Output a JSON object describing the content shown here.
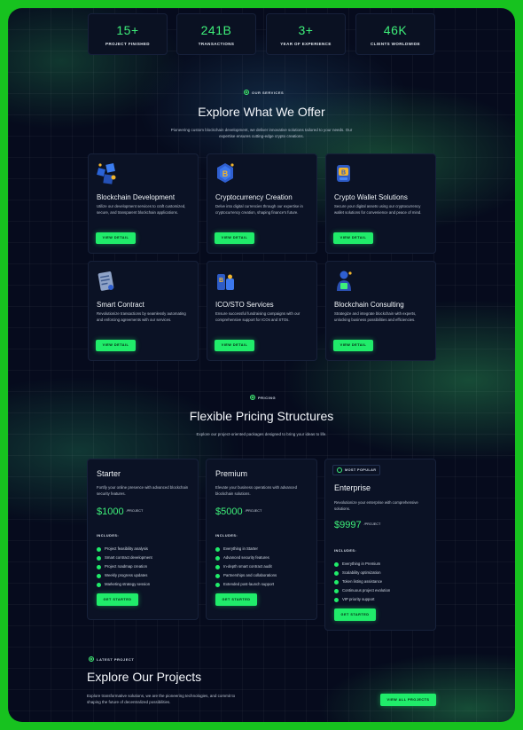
{
  "stats": [
    {
      "value": "15+",
      "label": "PROJECT FINISHED"
    },
    {
      "value": "241B",
      "label": "TRANSACTIONS"
    },
    {
      "value": "3+",
      "label": "YEAR OF EXPERIENCE"
    },
    {
      "value": "46K",
      "label": "CLIENTS WORLDWIDE"
    }
  ],
  "services": {
    "tag": "OUR SERVICES",
    "title": "Explore What We Offer",
    "subtitle": "Pioneering custom blockchain development, we deliver innovative solutions tailored to your needs. Our expertise ensures cutting-edge crypto creations.",
    "button_label": "VIEW DETAIL",
    "cards": [
      {
        "title": "Blockchain Development",
        "desc": "Utilize our development services to craft customized, secure, and transparent blockchain applications.",
        "icon": "blockchain-icon"
      },
      {
        "title": "Cryptocurrency Creation",
        "desc": "Delve into digital currencies through our expertise in cryptocurrency creation, shaping finance's future.",
        "icon": "bitcoin-coin-icon"
      },
      {
        "title": "Crypto Wallet Solutions",
        "desc": "Secure your digital assets using our cryptocurrency wallet solutions for convenience and peace of mind.",
        "icon": "crypto-wallet-icon"
      },
      {
        "title": "Smart Contract",
        "desc": "Revolutionize transactions by seamlessly automating and enforcing agreements with our services.",
        "icon": "contract-scroll-icon"
      },
      {
        "title": "ICO/STO Services",
        "desc": "Ensure successful fundraising campaigns with our comprehensive support for ICOs and STOs.",
        "icon": "coin-stack-icon"
      },
      {
        "title": "Blockchain Consulting",
        "desc": "Strategize and integrate blockchain with experts, unlocking business possibilities and efficiencies.",
        "icon": "consultant-icon"
      }
    ]
  },
  "pricing": {
    "tag": "PRICING",
    "title": "Flexible Pricing Structures",
    "subtitle": "Explore our project-oriented packages designed to bring your ideas to life.",
    "includes_label": "INCLUDES:",
    "button_label": "GET STARTED",
    "popular_label": "MOST POPULAR",
    "plans": [
      {
        "name": "Starter",
        "desc": "Fortify your online presence with advanced blockchain security features.",
        "price": "$1000",
        "per": "/PROJECT",
        "features": [
          "Project feasibility analysis",
          "Smart contract development",
          "Project roadmap creation",
          "Weekly progress updates",
          "Marketing strategy session"
        ]
      },
      {
        "name": "Premium",
        "desc": "Elevate your business operations with advanced blockchain solutions.",
        "price": "$5000",
        "per": "/PROJECT",
        "features": [
          "Everything in Starter",
          "Advanced security features",
          "In-depth smart contract audit",
          "Partnerships and collaborations",
          "Extended post-launch support"
        ]
      },
      {
        "name": "Enterprise",
        "desc": "Revolutionize your enterprise with comprehensive solutions.",
        "price": "$9997",
        "per": "/PROJECT",
        "features": [
          "Everything in Premium",
          "Scalability optimization",
          "Token listing assistance",
          "Continuous project evolution",
          "VIP priority support"
        ]
      }
    ]
  },
  "projects": {
    "tag": "LATEST PROJECT",
    "title": "Explore Our Projects",
    "desc": "Explore transformative solutions, we are the pioneering technologies, and commit to shaping the future of decentralized possibilities.",
    "button_label": "VIEW ALL PROJECTS"
  },
  "colors": {
    "accent": "#20ec6a",
    "background": "#060b1d",
    "card": "#0b1225",
    "frame": "#17c21f"
  }
}
